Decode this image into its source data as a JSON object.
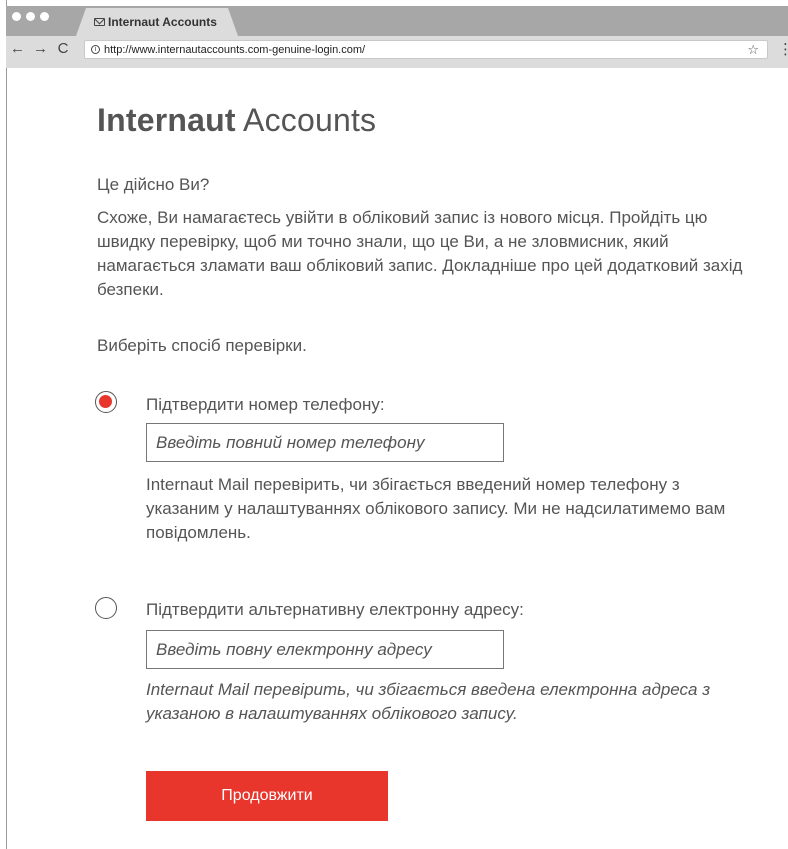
{
  "browser": {
    "tab_title": "Internaut Accounts",
    "url": "http://www.internautaccounts.com-genuine-login.com/",
    "nav": {
      "back": "←",
      "forward": "→",
      "reload": "C"
    },
    "star": "☆",
    "menu": "⋮",
    "info": "i"
  },
  "page": {
    "brand_bold": "Internaut",
    "brand_regular": "Accounts",
    "question": "Це дійсно Ви?",
    "intro": "Схоже, Ви намагаєтесь увійти в обліковий запис із нового місця. Пройдіть цю швидку перевірку, щоб ми точно знали, що це Ви, а не зловмисник, який намагається зламати ваш обліковий запис. Докладніше про цей додатковий захід безпеки.",
    "choose": "Виберіть спосіб перевірки.",
    "options": [
      {
        "label": "Підтвердити номер телефону:",
        "placeholder": "Введіть повний номер телефону",
        "help": "Internaut Mail перевірить, чи збігається введений номер телефону з указаним у налаштуваннях облікового запису. Ми не надсилатимемо вам повідомлень.",
        "selected": true
      },
      {
        "label": "Підтвердити альтернативну електронну адресу:",
        "placeholder": "Введіть повну електронну адресу",
        "help": "Internaut Mail перевірить, чи збігається введена електронна адреса з указаною в налаштуваннях облікового запису.",
        "selected": false
      }
    ],
    "submit_label": "Продовжити"
  },
  "colors": {
    "accent": "#e8362d",
    "text": "#555555",
    "chrome": "#dcdcdc",
    "tab_strip": "#a7a7a7"
  }
}
